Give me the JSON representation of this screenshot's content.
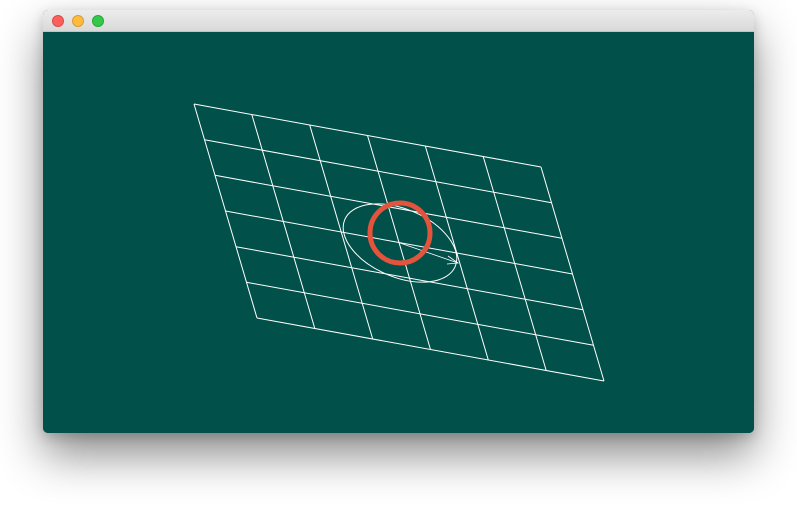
{
  "window": {
    "title": "",
    "buttons": [
      "close",
      "minimize",
      "zoom"
    ]
  },
  "colors": {
    "background": "#01514a",
    "grid": "#ffffff",
    "circle": "#e4533c",
    "close_button": "#fc605c",
    "minimize_button": "#fdbc40",
    "zoom_button": "#34c84a"
  },
  "grid": {
    "columns": 6,
    "rows": 6
  },
  "icons": {
    "close": "close-icon",
    "minimize": "minimize-icon",
    "zoom": "zoom-icon"
  }
}
